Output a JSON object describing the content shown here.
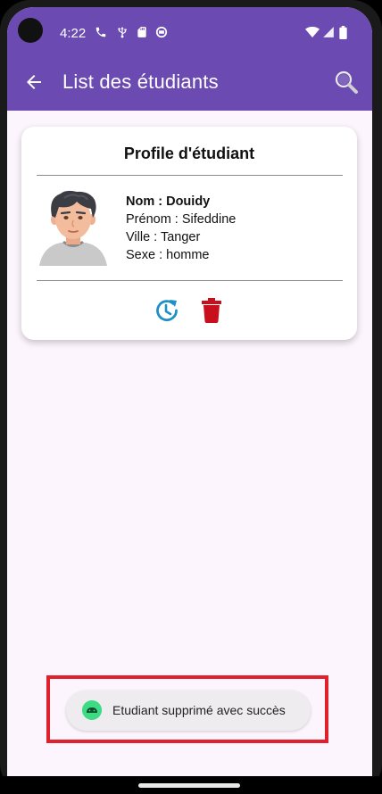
{
  "status_bar": {
    "time": "4:22",
    "left_icons": [
      "phone-icon",
      "usb-icon",
      "sd-card-icon",
      "circle-status-icon"
    ],
    "right_icons": [
      "wifi-icon",
      "signal-icon",
      "battery-icon"
    ]
  },
  "app_bar": {
    "title": "List des étudiants",
    "color": "#6b4ab2"
  },
  "card": {
    "title": "Profile d'étudiant",
    "nom": "Nom : Douidy",
    "prenom": "Prénom : Sifeddine",
    "ville": "Ville : Tanger",
    "sexe": "Sexe : homme",
    "update_color": "#1e90c8",
    "delete_color": "#c8101c"
  },
  "toast": {
    "message": "Etudiant supprimé avec succès",
    "highlight_color": "#e0202a"
  }
}
